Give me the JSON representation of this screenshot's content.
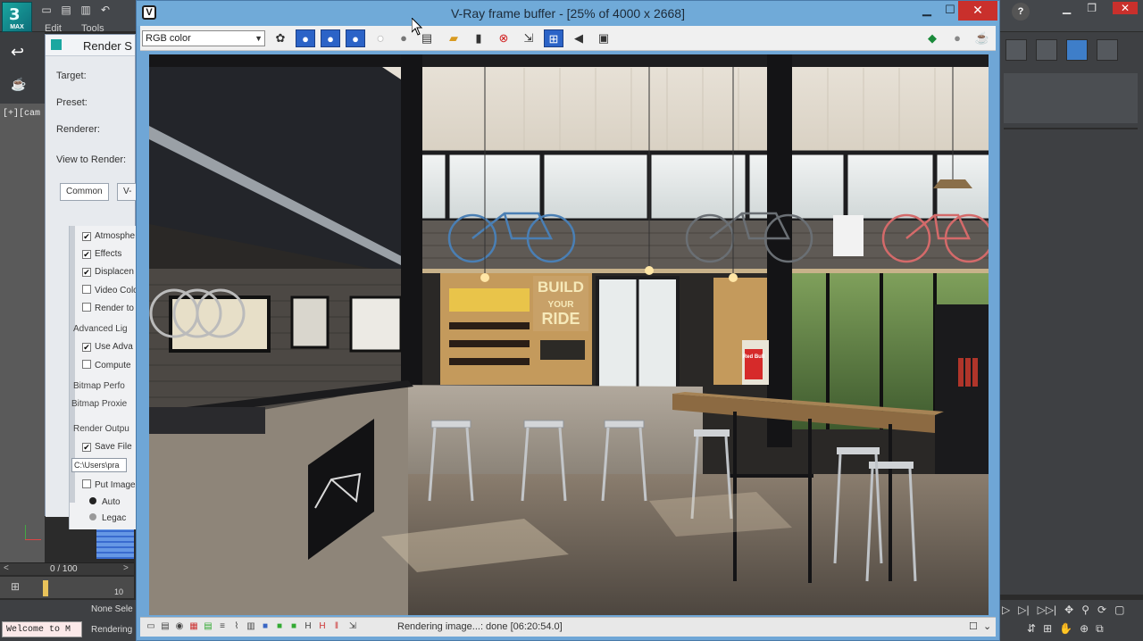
{
  "max": {
    "logo_label": "MAX",
    "menu": [
      "Edit",
      "Tools"
    ],
    "viewport_label": "[+][cam",
    "timeline_frame": "0 / 100",
    "ruler_tick": "10",
    "status_none_selected": "None Sele",
    "status_rendering": "Rendering",
    "welcome": "Welcome to M",
    "help": "?"
  },
  "render_setup": {
    "title": "Render S",
    "rows": {
      "target": "Target:",
      "preset": "Preset:",
      "renderer": "Renderer:",
      "view": "View to Render:"
    },
    "tabs": [
      "Common",
      "V-"
    ],
    "items": [
      {
        "label": "Atmosphe",
        "checked": true
      },
      {
        "label": "Effects",
        "checked": true
      },
      {
        "label": "Displacen",
        "checked": true
      },
      {
        "label": "Video Colo",
        "checked": false
      },
      {
        "label": "Render to",
        "checked": false
      }
    ],
    "group_advanced": "Advanced Lig",
    "adv_items": [
      {
        "label": "Use Adva",
        "checked": true
      },
      {
        "label": "Compute",
        "checked": false
      }
    ],
    "group_bitmap": "Bitmap Perfo",
    "bitmap_proxies": "Bitmap Proxie",
    "group_output": "Render Outpu",
    "save_file": {
      "label": "Save File",
      "checked": true
    },
    "path": "C:\\Users\\pra",
    "put_image": {
      "label": "Put Image",
      "checked": false
    },
    "radio_auto": "Auto",
    "radio_legacy": "Legac"
  },
  "vfb": {
    "title": "V-Ray frame buffer - [25% of 4000 x 2668]",
    "close": "✕",
    "channel": "RGB color",
    "status": "Rendering image...: done [06:20:54.0]",
    "sign_lines": [
      "BUILD",
      "YOUR",
      "RIDE"
    ],
    "can_label": "Red Bull"
  }
}
